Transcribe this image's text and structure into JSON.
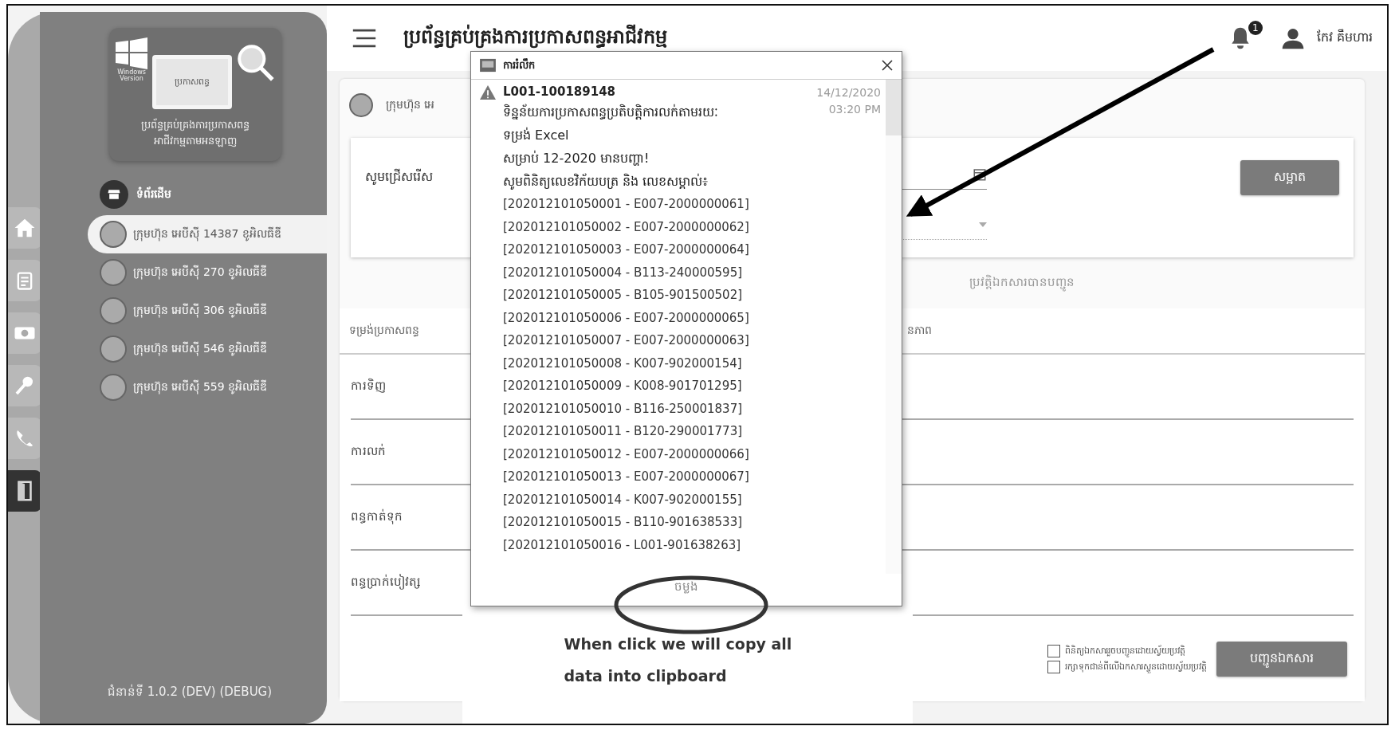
{
  "header": {
    "title": "ប្រព័ន្ធគ្រប់គ្រងការប្រកាសពន្ធអាជីវកម្ម",
    "notification_badge": "1",
    "user_name": "កែវ គឹមហារ"
  },
  "logo": {
    "windows_label": "Windows Version",
    "screen_text": "ប្រកាសពន្ធ",
    "caption": [
      "ប្រព័ន្ធគ្រប់គ្រងការប្រកាសពន្ធ",
      "អាជីវកម្មតាមអនឡាញ"
    ]
  },
  "sidebar": {
    "home": "ទំព័រដើម",
    "companies": [
      {
        "label": "ក្រុមហ៊ុន អេបីស៊ី 14387 ខូអិលធីឌី",
        "selected": true
      },
      {
        "label": "ក្រុមហ៊ុន អេបីស៊ី 270 ខូអិលធីឌី",
        "selected": false
      },
      {
        "label": "ក្រុមហ៊ុន អេបីស៊ី 306 ខូអិលធីឌី",
        "selected": false
      },
      {
        "label": "ក្រុមហ៊ុន អេបីស៊ី 546 ខូអិលធីឌី",
        "selected": false
      },
      {
        "label": "ក្រុមហ៊ុន អេបីស៊ី 559 ខូអិលធីឌី",
        "selected": false
      }
    ],
    "version": "ជំនាន់ទី 1.0.2 (DEV) (DEBUG)"
  },
  "content": {
    "company_name": "ក្រុមហ៊ុន អេ",
    "select_label": "សូមជ្រើសរើស",
    "clear_button": "សម្អាត",
    "tab": "ប្រវត្តិឯកសារបានបញ្ជូន",
    "table": {
      "columns": [
        "ទម្រង់ប្រកាសពន្ធ",
        "នភាព"
      ],
      "rows": [
        "ការទិញ",
        "ការលក់",
        "ពន្ធកាត់ទុក",
        "ពន្ធប្រាក់បៀវត្ស"
      ]
    },
    "options": [
      {
        "label": "ពិនិត្យឯកសាររួចបញ្ជូនដោយស្វ័យប្រវត្តិ",
        "checked": false
      },
      {
        "label": "រក្សាទុកជាន់ពីលើឯកសារស្ទួនដោយស្វ័យប្រវត្តិ",
        "checked": false
      }
    ],
    "submit_button": "បញ្ជូនឯកសារ"
  },
  "dialog": {
    "title": "ការរំលឹក",
    "message_title": "L001-100189148",
    "date": "14/12/2020",
    "time": "03:20 PM",
    "lines": [
      "ទិន្នន័យការប្រកាសពន្ធប្រតិបត្តិការលក់តាមរយៈ",
      "ទម្រង់ Excel",
      "សម្រាប់ 12-2020 មានបញ្ហា!",
      "សូមពិនិត្យលេខវិក័យបត្រ និង លេខសម្គាល់៖"
    ],
    "items": [
      "[202012101050001 - E007-2000000061]",
      "[202012101050002 - E007-2000000062]",
      "[202012101050003 - E007-2000000064]",
      "[202012101050004 - B113-240000595]",
      "[202012101050005 - B105-901500502]",
      "[202012101050006 - E007-2000000065]",
      "[202012101050007 - E007-2000000063]",
      "[202012101050008 - K007-902000154]",
      "[202012101050009 - K008-901701295]",
      "[202012101050010 - B116-250001837]",
      "[202012101050011 - B120-290001773]",
      "[202012101050012 - E007-2000000066]",
      "[202012101050013 - E007-2000000067]",
      "[202012101050014 - K007-902000155]",
      "[202012101050015 - B110-901638533]",
      "[202012101050016 - L001-901638263]"
    ],
    "copy_button": "ចម្លង"
  },
  "annotation": {
    "caption": "When click we will copy all data into clipboard"
  }
}
